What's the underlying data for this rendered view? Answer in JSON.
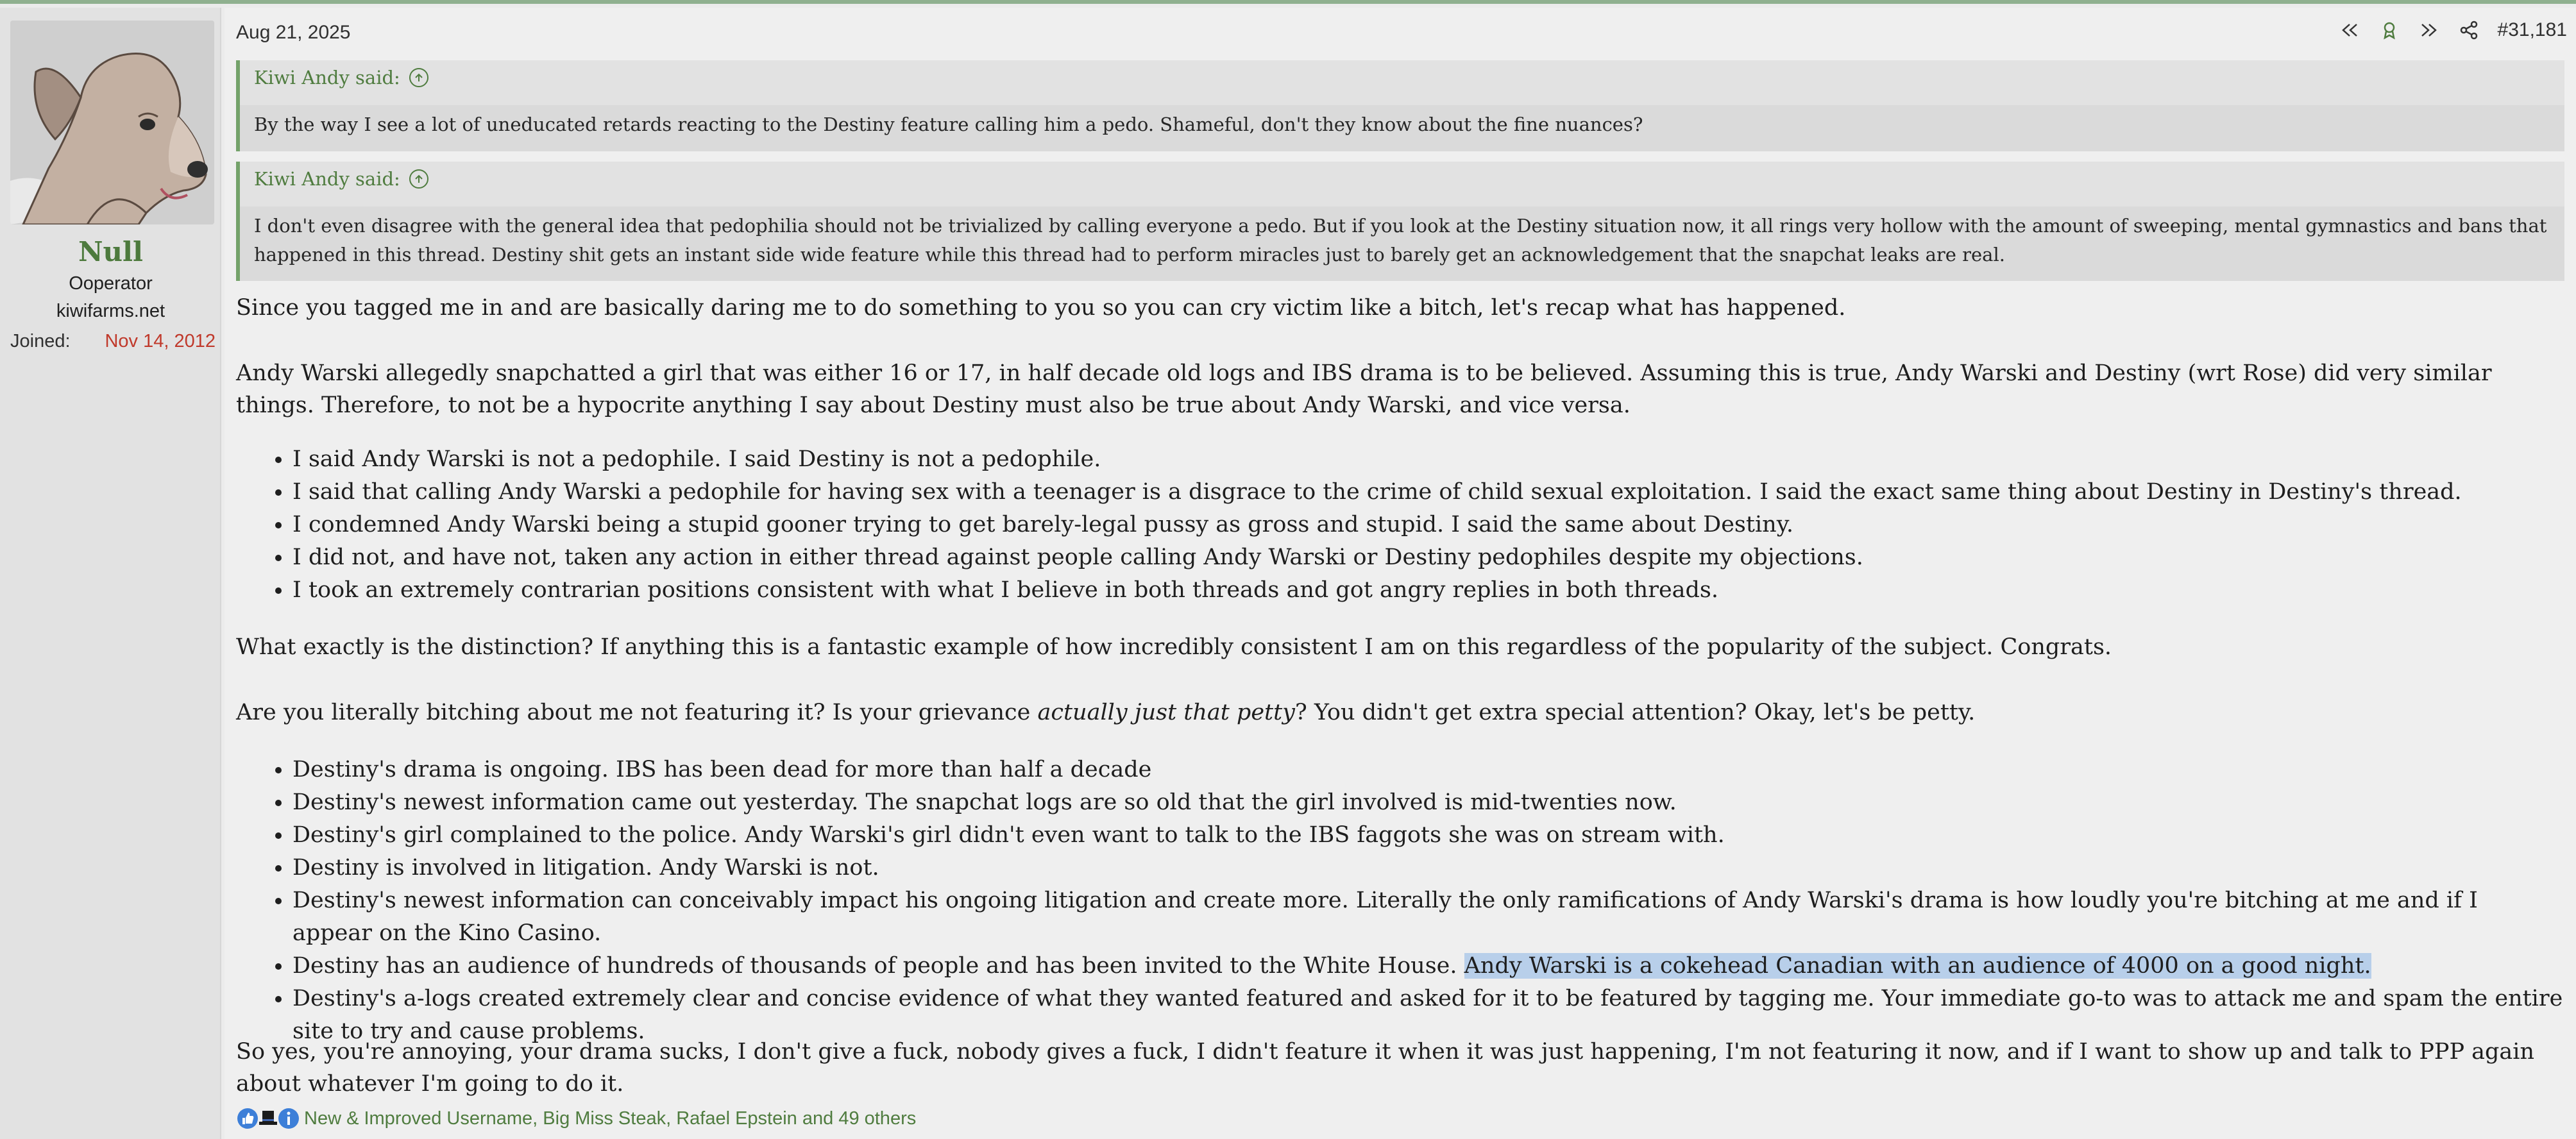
{
  "user": {
    "name": "Null",
    "title": "Ooperator",
    "site": "kiwifarms.net",
    "joined_label": "Joined:",
    "joined_date": "Nov 14, 2012",
    "name_color": "#4d7a3d"
  },
  "post": {
    "date": "Aug 21, 2025",
    "number": "#31,181",
    "tool_icons": [
      "first-icon",
      "tag-icon",
      "next-icon",
      "share-icon"
    ]
  },
  "quotes": [
    {
      "author": "Kiwi Andy said:",
      "text": "By the way I see a lot of uneducated retards reacting to the Destiny feature calling him a pedo. Shameful, don't they know about the fine nuances?"
    },
    {
      "author": "Kiwi Andy said:",
      "text": "I don't even disagree with the general idea that pedophilia should not be trivialized by calling everyone a pedo. But if you look at the Destiny situation now, it all rings very hollow with the amount of sweeping, mental gymnastics and bans that happened in this thread. Destiny shit gets an instant side wide feature while this thread had to perform miracles just to barely get an acknowledgement that the snapchat leaks are real."
    }
  ],
  "body": {
    "p1": "Since you tagged me in and are basically daring me to do something to you so you can cry victim like a bitch, let's recap what has happened.",
    "p2": "Andy Warski allegedly snapchatted a girl that was either 16 or 17, in half decade old logs and IBS drama is to be believed. Assuming this is true, Andy Warski and Destiny (wrt Rose) did very similar things. Therefore, to not be a hypocrite anything I say about Destiny must also be true about Andy Warski, and vice versa.",
    "list1": [
      "I said Andy Warski is not a pedophile. I said Destiny is not a pedophile.",
      "I said that calling Andy Warski a pedophile for having sex with a teenager is a disgrace to the crime of child sexual exploitation. I said the exact same thing about Destiny in Destiny's thread.",
      "I condemned Andy Warski being a stupid gooner trying to get barely-legal pussy as gross and stupid. I said the same about Destiny.",
      "I did not, and have not, taken any action in either thread against people calling Andy Warski or Destiny pedophiles despite my objections.",
      "I took an extremely contrarian positions consistent with what I believe in both threads and got angry replies in both threads."
    ],
    "p3": "What exactly is the distinction? If anything this is a fantastic example of how incredibly consistent I am on this regardless of the popularity of the subject. Congrats.",
    "p4_before": "Are you literally bitching about me not featuring it? Is your grievance ",
    "p4_em": "actually just that petty",
    "p4_after": "? You didn't get extra special attention? Okay, let's be petty.",
    "list2": [
      "Destiny's drama is ongoing. IBS has been dead for more than half a decade",
      "Destiny's newest information came out yesterday. The snapchat logs are so old that the girl involved is mid-twenties now.",
      "Destiny's girl complained to the police. Andy Warski's girl didn't even want to talk to the IBS faggots she was on stream with.",
      "Destiny is involved in litigation. Andy Warski is not.",
      "Destiny's newest information can conceivably impact his ongoing litigation and create more. Literally the only ramifications of Andy Warski's drama is how loudly you're bitching at me and if I appear on the Kino Casino."
    ],
    "list2_item6_before": "Destiny has an audience of hundreds of thousands of people and has been invited to the White House. ",
    "list2_item6_highlight": "Andy Warski is a cokehead Canadian with an audience of 4000 on a good night.",
    "list2_item7": "Destiny's a-logs created extremely clear and concise evidence of what they wanted featured and asked for it to be featured by tagging me. Your immediate go-to was to attack me and spam the entire site to try and cause problems.",
    "p5": "So yes, you're annoying, your drama sucks, I don't give a fuck, nobody gives a fuck, I didn't feature it when it was just happening, I'm not featuring it now, and if I want to show up and talk to PPP again about whatever I'm going to do it."
  },
  "reactions": {
    "text": "New & Improved Username, Big Miss Steak, Rafael Epstein and 49 others",
    "icons": [
      "thumbs-up-icon",
      "hat-icon",
      "info-icon"
    ]
  }
}
